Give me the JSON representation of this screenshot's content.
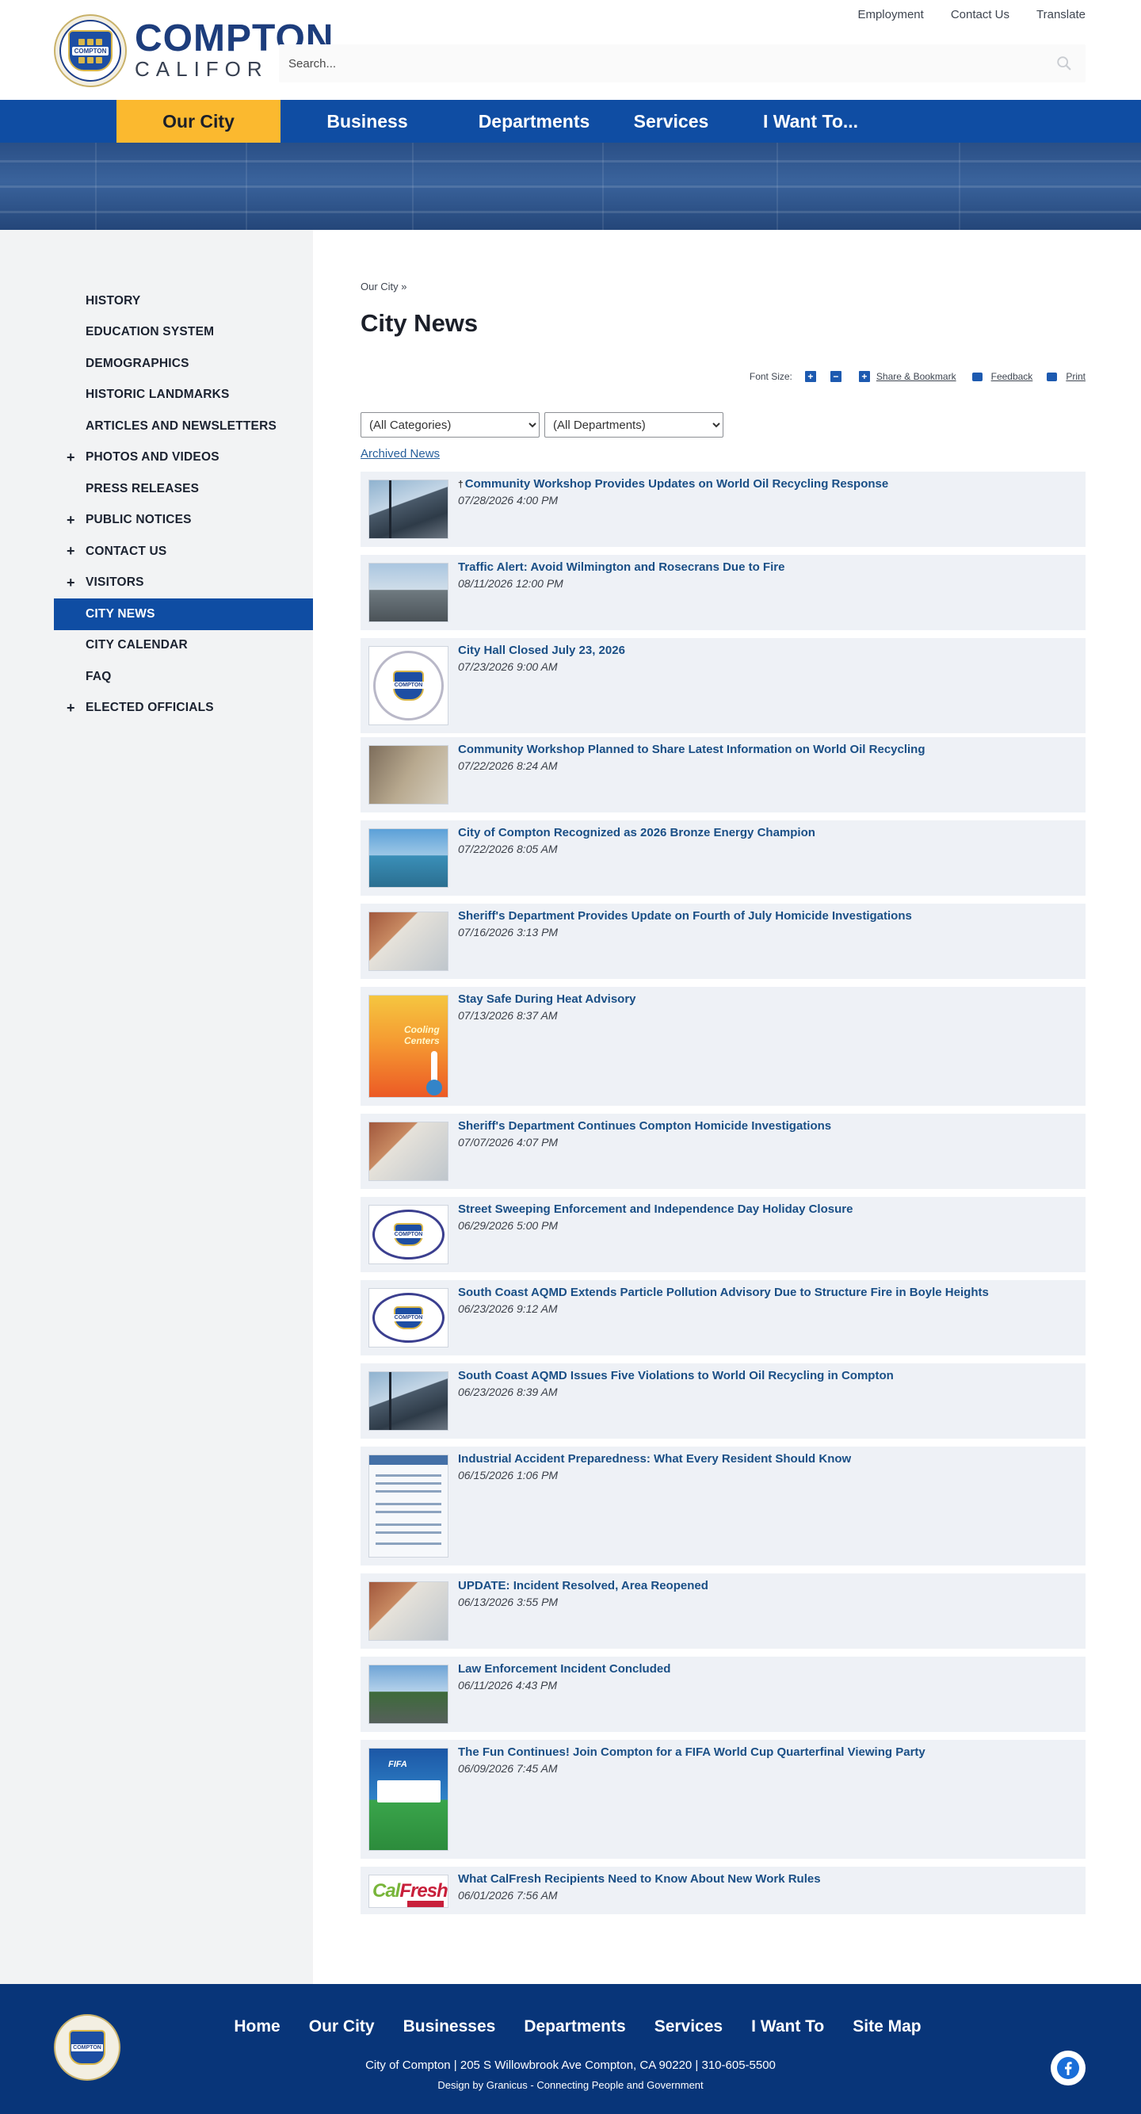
{
  "header": {
    "brand_top": "COMPTON",
    "brand_bottom": "CALIFOR",
    "search_placeholder": "Search...",
    "top_links": [
      "Employment",
      "Contact Us",
      "Translate"
    ]
  },
  "nav": [
    {
      "label": "Our City",
      "active": true
    },
    {
      "label": "Business",
      "active": false
    },
    {
      "label": "Departments",
      "active": false
    },
    {
      "label": "Services",
      "active": false
    },
    {
      "label": "I Want To...",
      "active": false
    }
  ],
  "sidebar": {
    "items": [
      {
        "label": "HISTORY",
        "expandable": false,
        "active": false
      },
      {
        "label": "EDUCATION SYSTEM",
        "expandable": false,
        "active": false
      },
      {
        "label": "DEMOGRAPHICS",
        "expandable": false,
        "active": false
      },
      {
        "label": "HISTORIC LANDMARKS",
        "expandable": false,
        "active": false
      },
      {
        "label": "ARTICLES AND NEWSLETTERS",
        "expandable": false,
        "active": false
      },
      {
        "label": "PHOTOS AND VIDEOS",
        "expandable": true,
        "active": false
      },
      {
        "label": "PRESS RELEASES",
        "expandable": false,
        "active": false
      },
      {
        "label": "PUBLIC NOTICES",
        "expandable": true,
        "active": false
      },
      {
        "label": "CONTACT US",
        "expandable": true,
        "active": false
      },
      {
        "label": "VISITORS",
        "expandable": true,
        "active": false
      },
      {
        "label": "CITY NEWS",
        "expandable": false,
        "active": true
      },
      {
        "label": "CITY CALENDAR",
        "expandable": false,
        "active": false
      },
      {
        "label": "FAQ",
        "expandable": false,
        "active": false
      },
      {
        "label": "ELECTED OFFICIALS",
        "expandable": true,
        "active": false
      }
    ],
    "expand_glyph": "+"
  },
  "main": {
    "breadcrumb": "Our City »",
    "title": "City News",
    "tools": {
      "font_size_label": "Font Size:",
      "increase": "+",
      "decrease": "−",
      "share_glyph": "+",
      "share": "Share & Bookmark",
      "feedback": "Feedback",
      "print": "Print"
    },
    "filters": {
      "categories": "(All Categories)",
      "departments": "(All Departments)"
    },
    "archived_link": "Archived News"
  },
  "news": [
    {
      "title": "Community Workshop Provides Updates on World Oil Recycling Response",
      "date": "07/28/2026 4:00 PM",
      "pinned": true,
      "thumb": "building",
      "thumb_label": ""
    },
    {
      "title": "Traffic Alert: Avoid Wilmington and Rosecrans Due to Fire",
      "date": "08/11/2026 12:00 PM",
      "pinned": false,
      "thumb": "street",
      "thumb_label": ""
    },
    {
      "title": "City Hall Closed July 23, 2026",
      "date": "07/23/2026 9:00 AM",
      "pinned": false,
      "thumb": "seal",
      "thumb_label": "COMPTON"
    },
    {
      "title": "Community Workshop Planned to Share Latest Information on World Oil Recycling",
      "date": "07/22/2026 8:24 AM",
      "pinned": false,
      "thumb": "stone",
      "thumb_label": ""
    },
    {
      "title": "City of Compton Recognized as 2026 Bronze Energy Champion",
      "date": "07/22/2026 8:05 AM",
      "pinned": false,
      "thumb": "glass",
      "thumb_label": ""
    },
    {
      "title": "Sheriff's Department Provides Update on Fourth of July Homicide Investigations",
      "date": "07/16/2026 3:13 PM",
      "pinned": false,
      "thumb": "brick",
      "thumb_label": ""
    },
    {
      "title": "Stay Safe During Heat Advisory",
      "date": "07/13/2026 8:37 AM",
      "pinned": false,
      "thumb": "heat",
      "thumb_label": "Cooling Centers"
    },
    {
      "title": "Sheriff's Department Continues Compton Homicide Investigations",
      "date": "07/07/2026 4:07 PM",
      "pinned": false,
      "thumb": "brick",
      "thumb_label": ""
    },
    {
      "title": "Street Sweeping Enforcement and Independence Day Holiday Closure",
      "date": "06/29/2026 5:00 PM",
      "pinned": false,
      "thumb": "oval",
      "thumb_label": "COMPTON"
    },
    {
      "title": "South Coast AQMD Extends Particle Pollution Advisory Due to Structure Fire in Boyle Heights",
      "date": "06/23/2026 9:12 AM",
      "pinned": false,
      "thumb": "oval",
      "thumb_label": "COMPTON"
    },
    {
      "title": "South Coast AQMD Issues Five Violations to World Oil Recycling in Compton",
      "date": "06/23/2026 8:39 AM",
      "pinned": false,
      "thumb": "building",
      "thumb_label": ""
    },
    {
      "title": "Industrial Accident Preparedness: What Every Resident Should Know",
      "date": "06/15/2026 1:06 PM",
      "pinned": false,
      "thumb": "flyer",
      "thumb_label": ""
    },
    {
      "title": "UPDATE: Incident Resolved, Area Reopened",
      "date": "06/13/2026 3:55 PM",
      "pinned": false,
      "thumb": "brick",
      "thumb_label": ""
    },
    {
      "title": "Law Enforcement Incident Concluded",
      "date": "06/11/2026 4:43 PM",
      "pinned": false,
      "thumb": "palm",
      "thumb_label": ""
    },
    {
      "title": "The Fun Continues! Join Compton for a FIFA World Cup Quarterfinal Viewing Party",
      "date": "06/09/2026 7:45 AM",
      "pinned": false,
      "thumb": "fifa",
      "thumb_label": "FIFA"
    },
    {
      "title": "What CalFresh Recipients Need to Know About New Work Rules",
      "date": "06/01/2026 7:56 AM",
      "pinned": false,
      "thumb": "fresh",
      "thumb_label": "CalFresh"
    }
  ],
  "footer": {
    "nav": [
      "Home",
      "Our City",
      "Businesses",
      "Departments",
      "Services",
      "I Want To",
      "Site Map"
    ],
    "address": "City of Compton  |  205 S Willowbrook Ave Compton, CA 90220  |  310-605-5500",
    "design": "Design by Granicus - Connecting People and Government"
  },
  "logo_label": "COMPTON",
  "colors": {
    "nav_bg": "#0f4da3",
    "nav_active": "#fbb92f",
    "footer_bg": "#083579",
    "link": "#1a4f86",
    "card_bg": "#eef1f6"
  }
}
